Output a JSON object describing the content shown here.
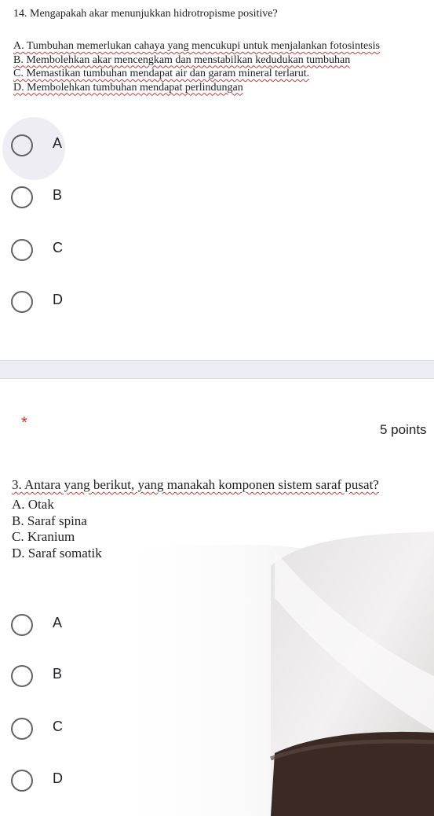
{
  "question14": {
    "title": "14. Mengapakah akar menunjukkan hidrotropisme positive?",
    "options": [
      "A. Tumbuhan memerlukan cahaya yang mencukupi untuk menjalankan fotosintesis",
      "B. Membolehkan akar mencengkam dan menstabilkan kedudukan tumbuhan",
      "C. Memastikan tumbuhan mendapat air dan garam mineral terlarut.",
      "D. Membolehkan tumbuhan mendapat perlindungan"
    ],
    "choices": [
      "A",
      "B",
      "C",
      "D"
    ]
  },
  "question3": {
    "required_mark": "*",
    "points": "5 points",
    "title": "3. Antara yang berikut, yang manakah komponen sistem saraf pusat?",
    "options": [
      "A. Otak",
      "B. Saraf spina",
      "C. Kranium",
      "D. Saraf somatik"
    ],
    "choices": [
      "A",
      "B",
      "C",
      "D"
    ]
  },
  "colors": {
    "radio_border": "#5f6368",
    "hover_highlight": "#efedf4",
    "divider": "#ecedf5",
    "required": "#d93025",
    "spellcheck": "#c23c3c"
  }
}
